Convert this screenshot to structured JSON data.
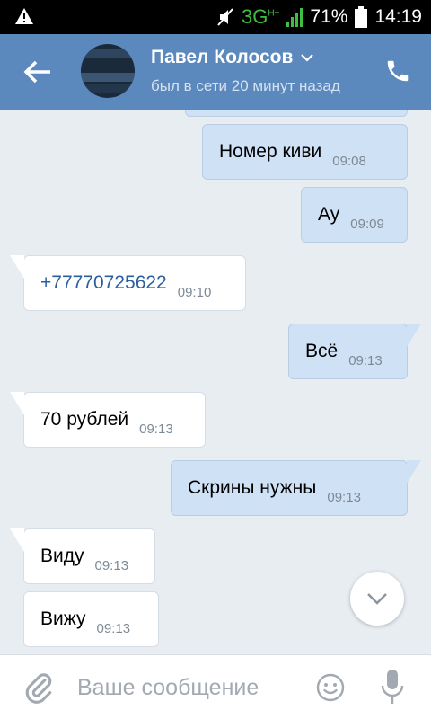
{
  "status_bar": {
    "network": "3G",
    "network_sup": "H+",
    "battery": "71%",
    "time": "14:19"
  },
  "header": {
    "name": "Павел Колосов",
    "subtitle": "был в сети 20 минут назад"
  },
  "messages": [
    {
      "dir": "out",
      "text": "Номер киви",
      "time": "09:08"
    },
    {
      "dir": "out",
      "text": "Ау",
      "time": "09:09"
    },
    {
      "dir": "in",
      "text": "+77770725622",
      "time": "09:10"
    },
    {
      "dir": "out",
      "text": "Всё",
      "time": "09:13"
    },
    {
      "dir": "in",
      "text": "70 рублей",
      "time": "09:13"
    },
    {
      "dir": "out",
      "text": "Скрины нужны",
      "time": "09:13"
    },
    {
      "dir": "in",
      "text": "Виду",
      "time": "09:13"
    },
    {
      "dir": "in",
      "text": "Вижу",
      "time": "09:13"
    }
  ],
  "composer": {
    "placeholder": "Ваше сообщение"
  },
  "colors": {
    "header": "#5b88bd",
    "outgoing_bubble": "#cfe1f5",
    "incoming_bubble": "#ffffff",
    "chat_background": "#e8edf2"
  }
}
